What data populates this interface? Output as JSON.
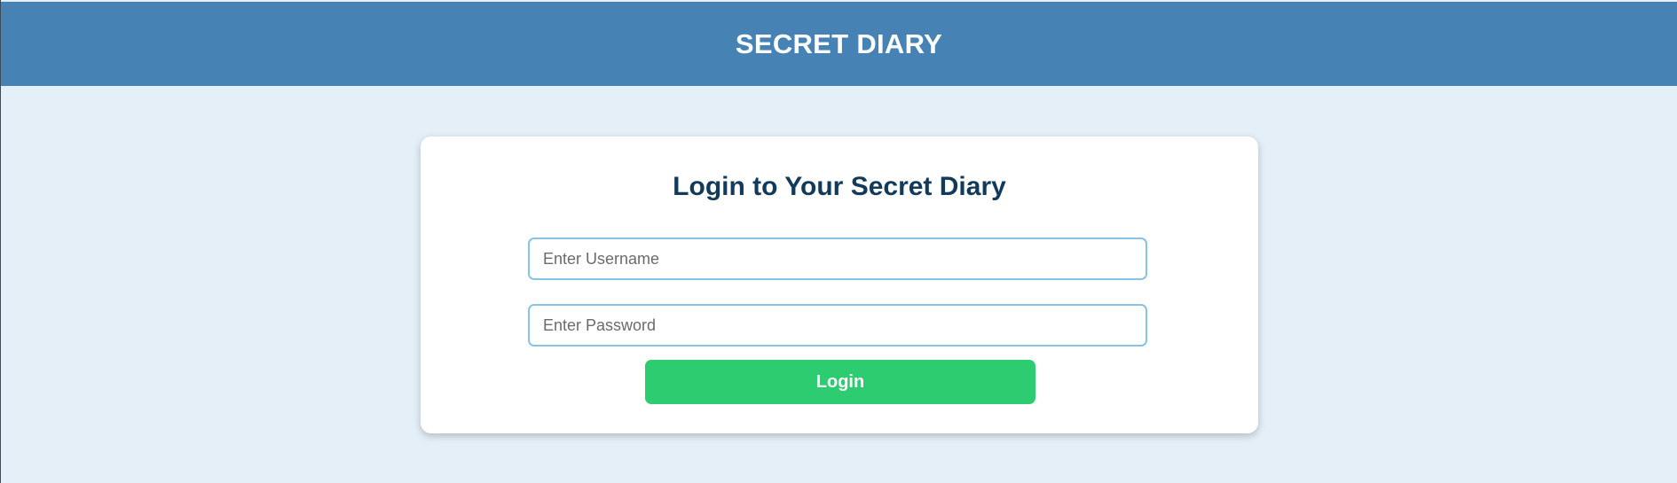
{
  "header": {
    "title": "SECRET DIARY"
  },
  "login": {
    "heading": "Login to Your Secret Diary",
    "username_placeholder": "Enter Username",
    "username_value": "",
    "password_placeholder": "Enter Password",
    "password_value": "",
    "button_label": "Login"
  },
  "colors": {
    "header_bg": "#4682b4",
    "page_bg": "#e5eff8",
    "heading_text": "#123a5a",
    "input_border": "#87c3e6",
    "button_bg": "#2ecc71"
  }
}
